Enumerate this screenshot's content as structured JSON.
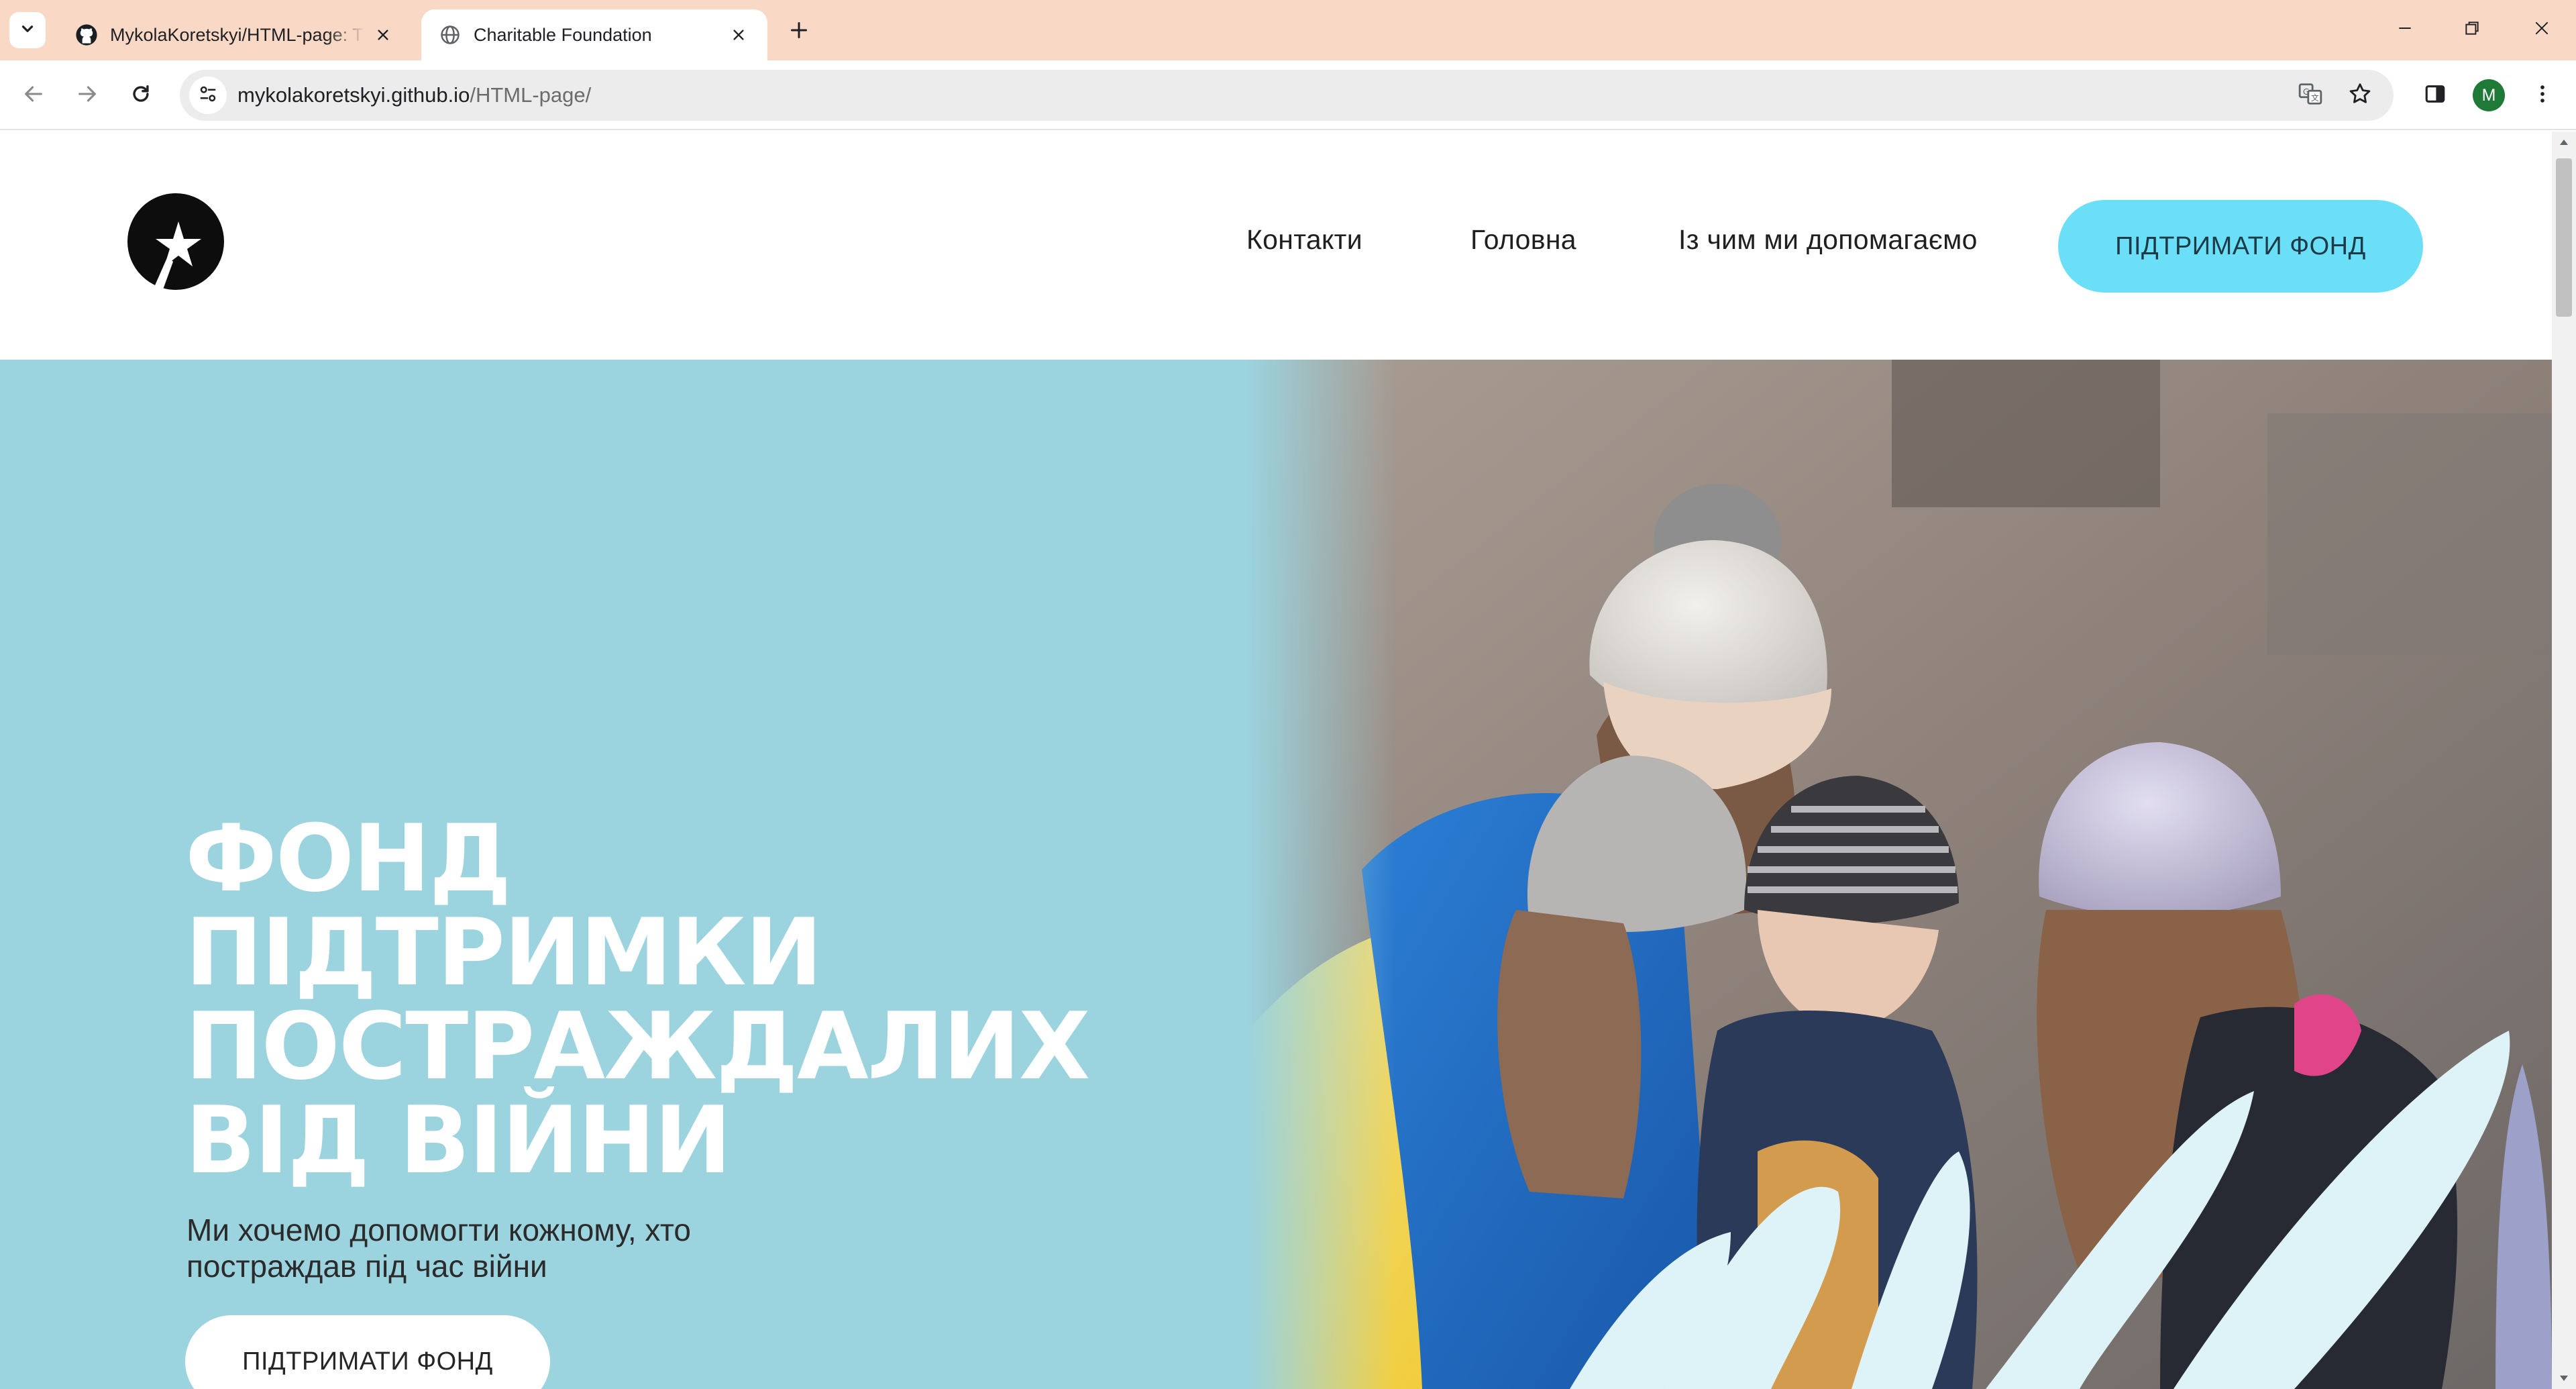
{
  "browser": {
    "tabs": [
      {
        "title": "MykolaKoretskyi/HTML-page: T",
        "icon": "github-icon",
        "active": false
      },
      {
        "title": "Charitable Foundation",
        "icon": "globe-icon",
        "active": true
      }
    ],
    "url_host": "mykolakoretskyi.github.io",
    "url_path": "/HTML-page/",
    "profile_initial": "M",
    "tabstrip_color": "#f9d9c6"
  },
  "site": {
    "nav": {
      "items": [
        "Контакти",
        "Головна",
        "Із чим ми допомагаємо"
      ],
      "cta_label": "ПІДТРИМАТИ ФОНД"
    },
    "hero": {
      "title_lines": [
        "ФОНД",
        "ПІДТРИМКИ",
        "ПОСТРАЖДАЛИХ",
        "ВІД ВІЙНИ"
      ],
      "subtitle_lines": [
        "Ми хочемо допомогти кожному, хто",
        "постраждав під час війни"
      ],
      "cta_label": "ПІДТРИМАТИ ФОНД"
    },
    "colors": {
      "hero_bg": "#9bd3de",
      "cta_top": "#6cdff8",
      "flag_blue": "#1f6fc9",
      "flag_yellow": "#f5d63a"
    }
  }
}
